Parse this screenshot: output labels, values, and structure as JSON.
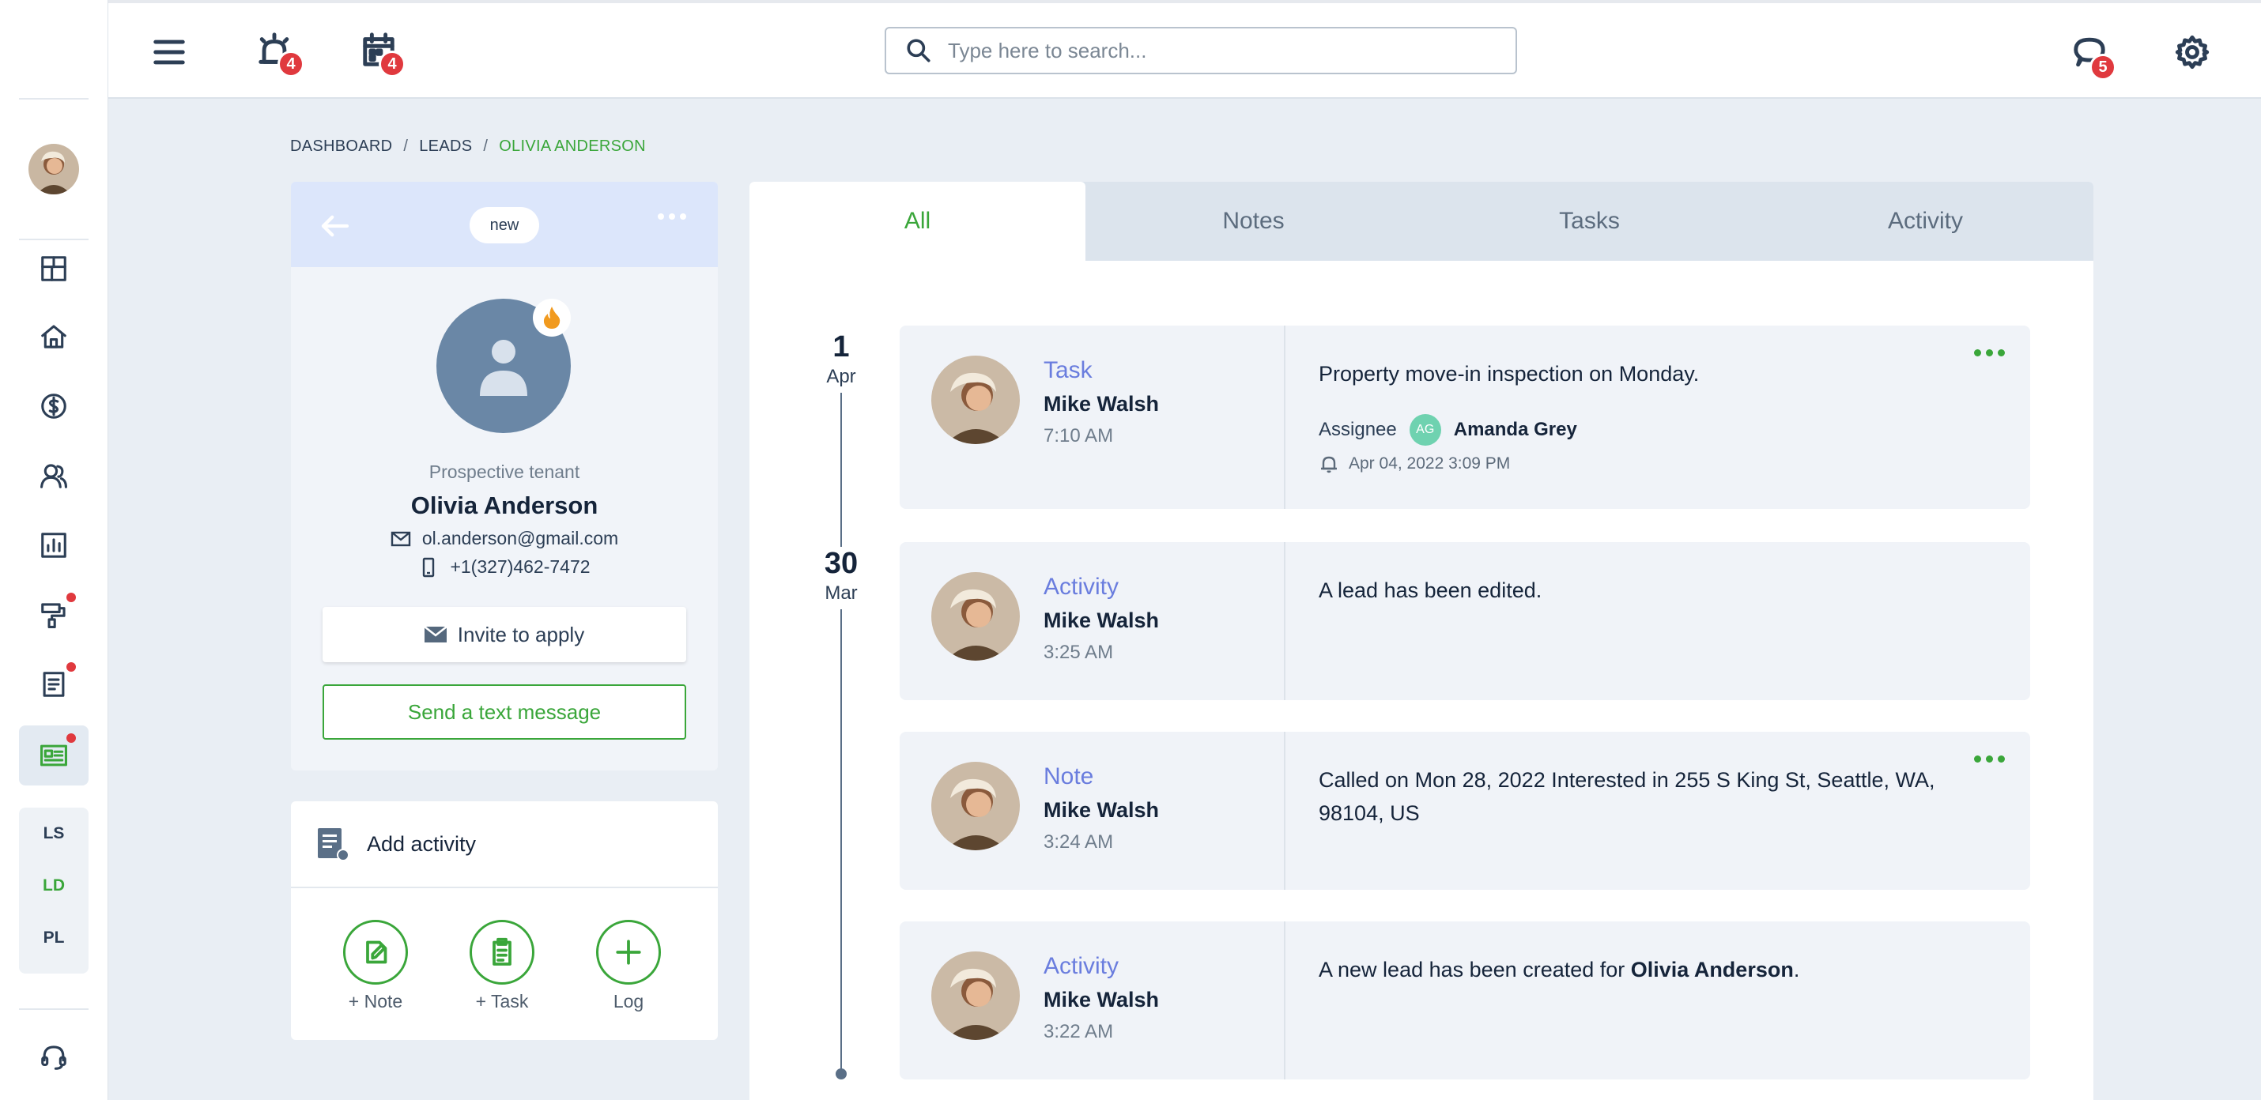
{
  "topbar": {
    "alerts_badge": "4",
    "calendar_badge": "4",
    "messages_badge": "5",
    "search_placeholder": "Type here to search..."
  },
  "sidebar": {
    "abbreviations": [
      "LS",
      "LD",
      "PL"
    ],
    "active_abbreviation": "LD"
  },
  "breadcrumb": [
    "DASHBOARD",
    "LEADS",
    "OLIVIA ANDERSON"
  ],
  "profile": {
    "status_pill": "new",
    "role": "Prospective tenant",
    "name": "Olivia Anderson",
    "email": "ol.anderson@gmail.com",
    "phone": "+1(327)462-7472",
    "invite_label": "Invite to apply",
    "text_label": "Send a text message"
  },
  "add_activity": {
    "title": "Add activity",
    "buttons": [
      "+ Note",
      "+ Task",
      "Log"
    ]
  },
  "tabs": [
    "All",
    "Notes",
    "Tasks",
    "Activity"
  ],
  "active_tab": "All",
  "dates": [
    {
      "day": "1",
      "month": "Apr"
    },
    {
      "day": "30",
      "month": "Mar"
    }
  ],
  "entries": [
    {
      "type": "Task",
      "author": "Mike Walsh",
      "time": "7:10 AM",
      "text": "Property move-in inspection on Monday.",
      "assignee_label": "Assignee",
      "assignee_initials": "AG",
      "assignee_name": "Amanda Grey",
      "reminder": "Apr 04, 2022 3:09 PM"
    },
    {
      "type": "Activity",
      "author": "Mike Walsh",
      "time": "3:25 AM",
      "text": "A lead has been edited."
    },
    {
      "type": "Note",
      "author": "Mike Walsh",
      "time": "3:24 AM",
      "text": "Called on Mon 28, 2022 Interested in 255 S King St, Seattle, WA, 98104, US"
    },
    {
      "type": "Activity",
      "author": "Mike Walsh",
      "time": "3:22 AM",
      "text_prefix": "A new lead has been created for ",
      "text_bold": "Olivia Anderson",
      "text_suffix": "."
    }
  ],
  "colors": {
    "accent_green": "#3aa63a",
    "badge_red": "#e0393e",
    "entry_type_purple": "#6a7dde",
    "avatar_slate": "#6a87a6"
  }
}
